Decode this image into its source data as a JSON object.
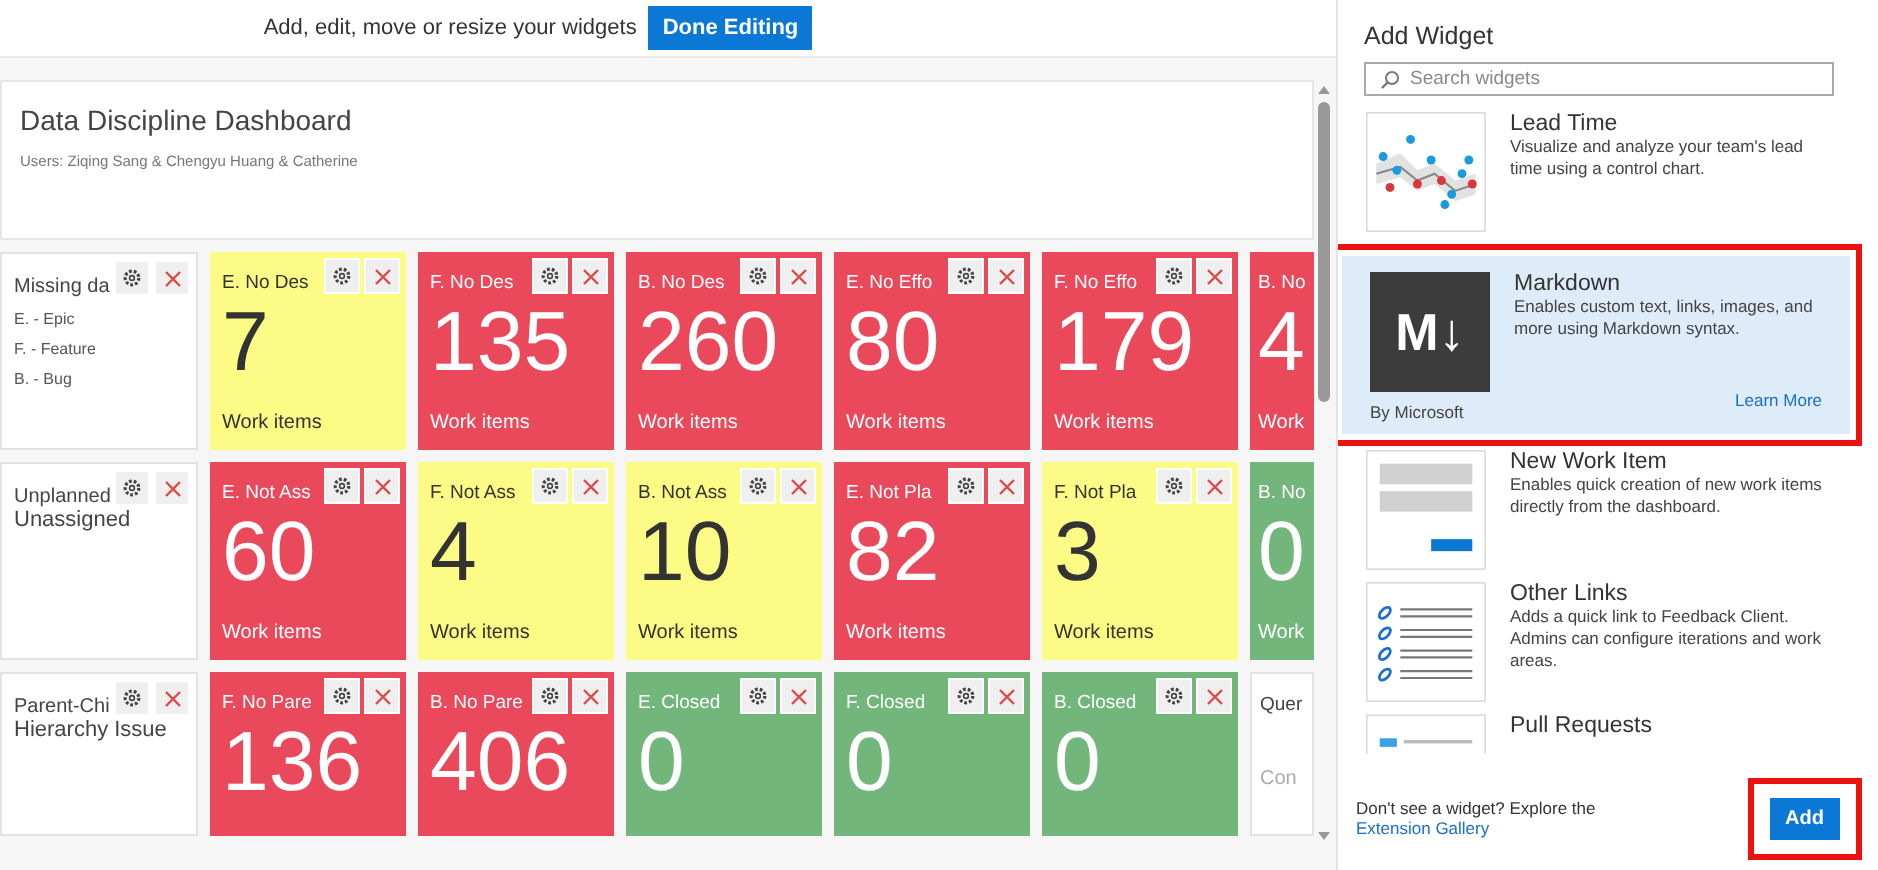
{
  "edit_bar": {
    "message": "Add, edit, move or resize your widgets",
    "button": "Done Editing"
  },
  "dashboard": {
    "title": "Data Discipline Dashboard",
    "subtitle": "Users: Ziqing Sang & Chengyu Huang & Catherine"
  },
  "rows": [
    {
      "label": {
        "title": "Missing da",
        "lines": [
          "E. - Epic",
          "F. - Feature",
          "B. - Bug"
        ]
      },
      "tiles": [
        {
          "kind": "count",
          "title": "E. No Des",
          "count": "7",
          "caption": "Work items",
          "color": "#fbfb86"
        },
        {
          "kind": "count",
          "title": "F. No Des",
          "count": "135",
          "caption": "Work items",
          "color": "#e9495a"
        },
        {
          "kind": "count",
          "title": "B. No Des",
          "count": "260",
          "caption": "Work items",
          "color": "#e9495a"
        },
        {
          "kind": "count",
          "title": "E. No Effo",
          "count": "80",
          "caption": "Work items",
          "color": "#e9495a"
        },
        {
          "kind": "count",
          "title": "F. No Effo",
          "count": "179",
          "caption": "Work items",
          "color": "#e9495a"
        },
        {
          "kind": "partial",
          "title": "B. No",
          "count": "4",
          "caption": "Work",
          "color": "#e9495a"
        }
      ]
    },
    {
      "label": {
        "title": "Unplanned",
        "lines": [
          "Unassigned"
        ]
      },
      "tiles": [
        {
          "kind": "count",
          "title": "E. Not Ass",
          "count": "60",
          "caption": "Work items",
          "color": "#e9495a"
        },
        {
          "kind": "count",
          "title": "F. Not Ass",
          "count": "4",
          "caption": "Work items",
          "color": "#fbfb86"
        },
        {
          "kind": "count",
          "title": "B. Not Ass",
          "count": "10",
          "caption": "Work items",
          "color": "#fbfb86"
        },
        {
          "kind": "count",
          "title": "E. Not Pla",
          "count": "82",
          "caption": "Work items",
          "color": "#e9495a"
        },
        {
          "kind": "count",
          "title": "F. Not Pla",
          "count": "3",
          "caption": "Work items",
          "color": "#fbfb86"
        },
        {
          "kind": "partial",
          "title": "B. No",
          "count": "0",
          "caption": "Work",
          "color": "#72b67c"
        }
      ]
    },
    {
      "label": {
        "title": "Parent-Chi",
        "lines": [
          "Hierarchy Issue"
        ]
      },
      "tiles": [
        {
          "kind": "count",
          "title": "F. No Pare",
          "count": "136",
          "color": "#e9495a"
        },
        {
          "kind": "count",
          "title": "B. No Pare",
          "count": "406",
          "color": "#e9495a"
        },
        {
          "kind": "count",
          "title": "E. Closed",
          "count": "0",
          "color": "#72b67c"
        },
        {
          "kind": "count",
          "title": "F. Closed",
          "count": "0",
          "color": "#72b67c"
        },
        {
          "kind": "count",
          "title": "B. Closed",
          "count": "0",
          "color": "#72b67c"
        },
        {
          "kind": "query",
          "title": "Quer",
          "count": "Con"
        }
      ]
    }
  ],
  "panel": {
    "title": "Add Widget",
    "search": {
      "placeholder": "Search widgets"
    },
    "widgets": [
      {
        "kind": "lead-time",
        "name": "Lead Time",
        "description": "Visualize and analyze your team's lead time using a control chart.",
        "selected": false,
        "highlighted": false
      },
      {
        "kind": "markdown",
        "name": "Markdown",
        "description": "Enables custom text, links, images, and more using Markdown syntax.",
        "logo": "M↓",
        "publisher": "By Microsoft",
        "link": "Learn More",
        "selected": true,
        "highlighted": true
      },
      {
        "kind": "new-work-item",
        "name": "New Work Item",
        "description": "Enables quick creation of new work items directly from the dashboard.",
        "selected": false,
        "highlighted": false
      },
      {
        "kind": "links",
        "name": "Other Links",
        "description": "Adds a quick link to Feedback Client. Admins can configure iterations and work areas.",
        "selected": false,
        "highlighted": false
      },
      {
        "kind": "pull-requests",
        "name": "Pull Requests",
        "selected": false,
        "highlighted": false
      }
    ],
    "footer": {
      "text": "Don't see a widget? Explore the",
      "link": "Extension Gallery",
      "button": "Add",
      "button_highlighted": true
    }
  }
}
